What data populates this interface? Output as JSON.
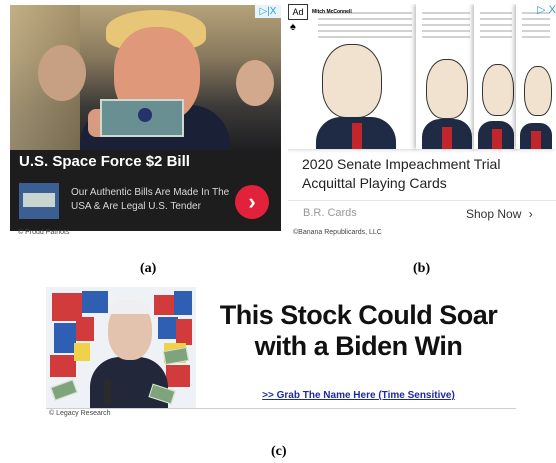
{
  "ad_a": {
    "title": "U.S. Space Force $2 Bill",
    "description": "Our Authentic Bills Are Made In The USA & Are Legal U.S. Tender",
    "cta_icon": "chevron-right-icon",
    "adchoices_label": "▷|X",
    "credit": "© Proud Patriots",
    "label": "(a)",
    "colors": {
      "background": "#1d1d1d",
      "cta": "#e2213b"
    }
  },
  "ad_b": {
    "ad_badge": "Ad",
    "card_name": "Mitch McConnell",
    "adchoices_label": "▷ X",
    "title": "2020 Senate Impeachment Trial Acquittal Playing Cards",
    "brand": "B.R. Cards",
    "cta": "Shop Now",
    "cta_icon": "chevron-right-icon",
    "credit": "©Banana Republicards, LLC",
    "label": "(b)"
  },
  "ad_c": {
    "headline": "This Stock Could Soar with a Biden Win",
    "link": ">> Grab The Name Here (Time Sensitive)",
    "credit": "© Legacy Research",
    "label": "(c)",
    "colors": {
      "link": "#1c2aa6",
      "headline": "#111111"
    }
  }
}
